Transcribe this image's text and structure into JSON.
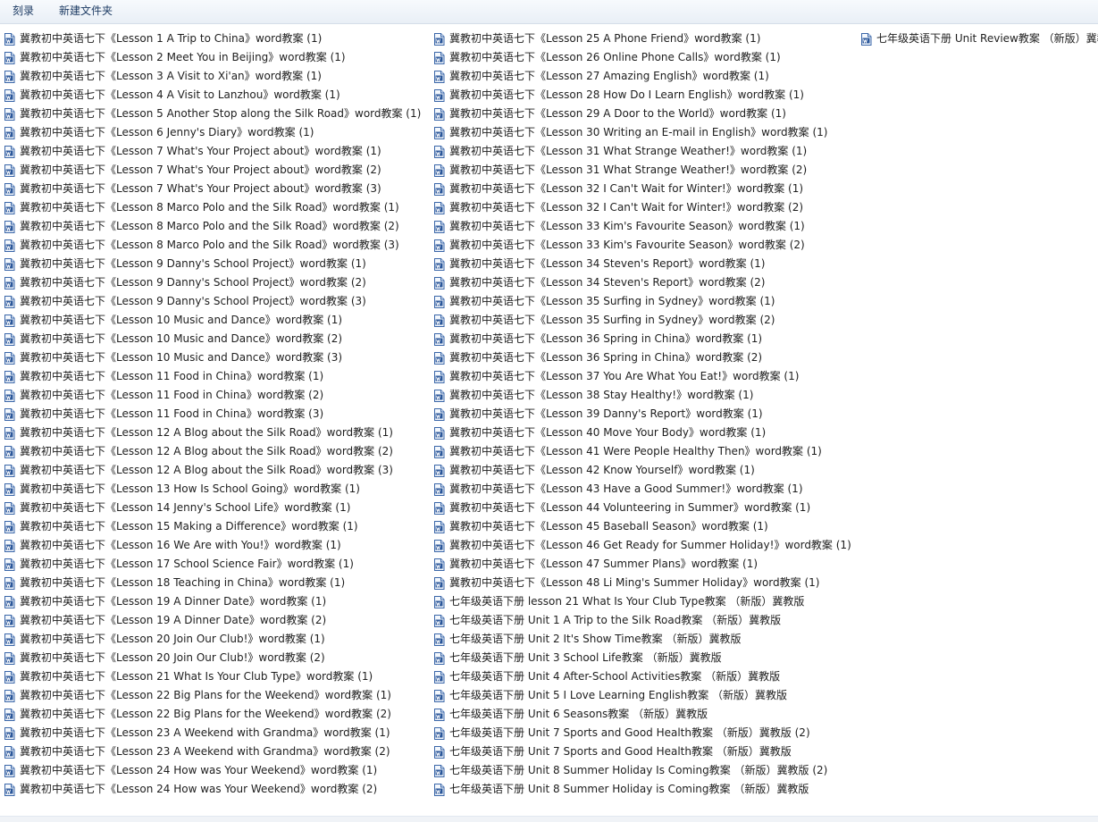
{
  "toolbar": {
    "burn_label": "刻录",
    "new_folder_label": "新建文件夹"
  },
  "files": {
    "icon": "word-document-icon",
    "column1": [
      "冀教初中英语七下《Lesson 1 A Trip to China》word教案 (1)",
      "冀教初中英语七下《Lesson 2 Meet You in Beijing》word教案 (1)",
      "冀教初中英语七下《Lesson 3 A Visit to Xi'an》word教案 (1)",
      "冀教初中英语七下《Lesson 4 A Visit to Lanzhou》word教案 (1)",
      "冀教初中英语七下《Lesson 5 Another Stop along the Silk Road》word教案 (1)",
      "冀教初中英语七下《Lesson 6 Jenny's Diary》word教案 (1)",
      "冀教初中英语七下《Lesson 7 What's Your Project about》word教案 (1)",
      "冀教初中英语七下《Lesson 7 What's Your Project about》word教案 (2)",
      "冀教初中英语七下《Lesson 7 What's Your Project about》word教案 (3)",
      "冀教初中英语七下《Lesson 8 Marco Polo and the Silk Road》word教案 (1)",
      "冀教初中英语七下《Lesson 8 Marco Polo and the Silk Road》word教案 (2)",
      "冀教初中英语七下《Lesson 8 Marco Polo and the Silk Road》word教案 (3)",
      "冀教初中英语七下《Lesson 9 Danny's School Project》word教案 (1)",
      "冀教初中英语七下《Lesson 9 Danny's School Project》word教案 (2)",
      "冀教初中英语七下《Lesson 9 Danny's School Project》word教案 (3)",
      "冀教初中英语七下《Lesson 10 Music and Dance》word教案 (1)",
      "冀教初中英语七下《Lesson 10 Music and Dance》word教案 (2)",
      "冀教初中英语七下《Lesson 10 Music and Dance》word教案 (3)",
      "冀教初中英语七下《Lesson 11 Food in China》word教案 (1)",
      "冀教初中英语七下《Lesson 11 Food in China》word教案 (2)",
      "冀教初中英语七下《Lesson 11 Food in China》word教案 (3)",
      "冀教初中英语七下《Lesson 12 A Blog about the Silk Road》word教案 (1)",
      "冀教初中英语七下《Lesson 12 A Blog about the Silk Road》word教案 (2)",
      "冀教初中英语七下《Lesson 12 A Blog about the Silk Road》word教案 (3)",
      "冀教初中英语七下《Lesson 13 How Is School Going》word教案 (1)",
      "冀教初中英语七下《Lesson 14 Jenny's School Life》word教案 (1)",
      "冀教初中英语七下《Lesson 15 Making a Difference》word教案 (1)",
      "冀教初中英语七下《Lesson 16 We Are with You!》word教案 (1)",
      "冀教初中英语七下《Lesson 17 School Science Fair》word教案 (1)",
      "冀教初中英语七下《Lesson 18 Teaching in China》word教案 (1)",
      "冀教初中英语七下《Lesson 19 A Dinner Date》word教案 (1)",
      "冀教初中英语七下《Lesson 19 A Dinner Date》word教案 (2)",
      "冀教初中英语七下《Lesson 20 Join Our Club!》word教案 (1)",
      "冀教初中英语七下《Lesson 20 Join Our Club!》word教案 (2)",
      "冀教初中英语七下《Lesson 21 What Is Your Club Type》word教案 (1)",
      "冀教初中英语七下《Lesson 22 Big Plans for the Weekend》word教案 (1)",
      "冀教初中英语七下《Lesson 22 Big Plans for the Weekend》word教案 (2)",
      "冀教初中英语七下《Lesson 23 A Weekend with Grandma》word教案 (1)",
      "冀教初中英语七下《Lesson 23 A Weekend with Grandma》word教案 (2)",
      "冀教初中英语七下《Lesson 24 How was Your Weekend》word教案 (1)",
      "冀教初中英语七下《Lesson 24 How was Your Weekend》word教案 (2)"
    ],
    "column2": [
      "冀教初中英语七下《Lesson 25 A Phone Friend》word教案 (1)",
      "冀教初中英语七下《Lesson 26 Online Phone Calls》word教案 (1)",
      "冀教初中英语七下《Lesson 27 Amazing English》word教案 (1)",
      "冀教初中英语七下《Lesson 28 How Do I Learn English》word教案 (1)",
      "冀教初中英语七下《Lesson 29 A Door to the World》word教案 (1)",
      "冀教初中英语七下《Lesson 30 Writing an E-mail in English》word教案 (1)",
      "冀教初中英语七下《Lesson 31 What Strange Weather!》word教案 (1)",
      "冀教初中英语七下《Lesson 31 What Strange Weather!》word教案 (2)",
      "冀教初中英语七下《Lesson 32 I Can't Wait for Winter!》word教案 (1)",
      "冀教初中英语七下《Lesson 32 I Can't Wait for Winter!》word教案 (2)",
      "冀教初中英语七下《Lesson 33 Kim's Favourite Season》word教案 (1)",
      "冀教初中英语七下《Lesson 33 Kim's Favourite Season》word教案 (2)",
      "冀教初中英语七下《Lesson 34 Steven's Report》word教案 (1)",
      "冀教初中英语七下《Lesson 34 Steven's Report》word教案 (2)",
      "冀教初中英语七下《Lesson 35 Surfing in Sydney》word教案 (1)",
      "冀教初中英语七下《Lesson 35 Surfing in Sydney》word教案 (2)",
      "冀教初中英语七下《Lesson 36 Spring in China》word教案 (1)",
      "冀教初中英语七下《Lesson 36 Spring in China》word教案 (2)",
      "冀教初中英语七下《Lesson 37 You Are What You Eat!》word教案 (1)",
      "冀教初中英语七下《Lesson 38 Stay Healthy!》word教案 (1)",
      "冀教初中英语七下《Lesson 39 Danny's Report》word教案 (1)",
      "冀教初中英语七下《Lesson 40 Move Your Body》word教案 (1)",
      "冀教初中英语七下《Lesson 41 Were People Healthy Then》word教案 (1)",
      "冀教初中英语七下《Lesson 42 Know Yourself》word教案 (1)",
      "冀教初中英语七下《Lesson 43 Have a Good Summer!》word教案 (1)",
      "冀教初中英语七下《Lesson 44 Volunteering in Summer》word教案 (1)",
      "冀教初中英语七下《Lesson 45 Baseball Season》word教案 (1)",
      "冀教初中英语七下《Lesson 46 Get Ready for Summer Holiday!》word教案 (1)",
      "冀教初中英语七下《Lesson 47 Summer Plans》word教案 (1)",
      "冀教初中英语七下《Lesson 48 Li Ming's Summer Holiday》word教案 (1)",
      "七年级英语下册 lesson 21 What Is Your Club Type教案 （新版）冀教版",
      "七年级英语下册 Unit 1 A Trip to the Silk Road教案 （新版）冀教版",
      "七年级英语下册 Unit 2 It's Show Time教案 （新版）冀教版",
      "七年级英语下册 Unit 3 School Life教案 （新版）冀教版",
      "七年级英语下册 Unit 4 After-School Activities教案 （新版）冀教版",
      "七年级英语下册 Unit 5 I Love Learning English教案 （新版）冀教版",
      "七年级英语下册 Unit 6 Seasons教案 （新版）冀教版",
      "七年级英语下册 Unit 7 Sports and Good Health教案 （新版）冀教版 (2)",
      "七年级英语下册 Unit 7 Sports and Good Health教案 （新版）冀教版",
      "七年级英语下册 Unit 8 Summer Holiday Is Coming教案 （新版）冀教版 (2)",
      "七年级英语下册 Unit 8 Summer Holiday is Coming教案 （新版）冀教版"
    ],
    "column3": [
      "七年级英语下册 Unit Review教案 （新版）冀教版"
    ]
  }
}
